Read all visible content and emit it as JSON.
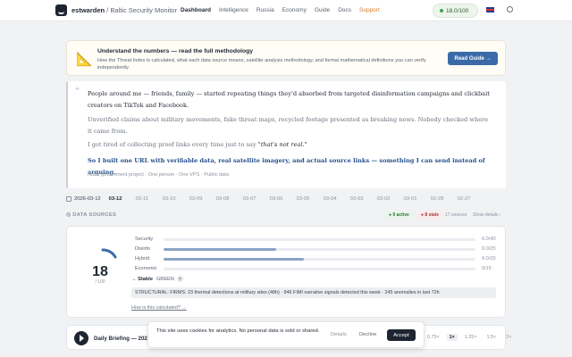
{
  "nav": {
    "brand": "estwarden",
    "subtitle": " / Baltic Security Monitor",
    "links": [
      "Dashboard",
      "Intelligence",
      "Russia",
      "Economy",
      "Guide",
      "Docs",
      "Support"
    ],
    "score": "18.0/100",
    "language_icon": "uk-flag-icon",
    "theme_icon": "moon-icon"
  },
  "banner": {
    "title": "Understand the numbers — read the full methodology",
    "description": "How the Threat Index is calculated, what each data source means, satellite analysis methodology, and formal mathematical definitions you can verify independently.",
    "button": "Read Guide →"
  },
  "quote": {
    "p1": "People around me — friends, family — started repeating things they'd absorbed from targeted disinformation campaigns and clickbait creators on TikTok and Facebook.",
    "p2": "Unverified claims about military movements, fake threat maps, recycled footage presented as breaking news. Nobody checked where it came from.",
    "p3_lead": "I got tired of collecting proof links every time just to say ",
    "p3_emph": "\"that's not real.\"",
    "p4": "So I built one URL with verifiable data, real satellite imagery, and actual source links — something I can send instead of arguing.",
    "footer": "Not a government project · One person · One VPS · Public data"
  },
  "dates": {
    "first": "2026-03-12",
    "items": [
      "03-12",
      "03-11",
      "03-10",
      "03-09",
      "03-08",
      "03-07",
      "03-06",
      "03-05",
      "03-04",
      "03-03",
      "03-02",
      "03-01",
      "02-28",
      "02-27"
    ]
  },
  "sources": {
    "label": "DATA SOURCES",
    "active": "● 9 active",
    "stale": "● 8 stale",
    "count": "17 sources",
    "toggle": "Show details ›"
  },
  "index": {
    "value": "18",
    "out_of": "/ 100",
    "trend": "→ Stable",
    "level": "GREEN",
    "help": "?",
    "components": [
      {
        "name": "Security",
        "value": "0.0/40",
        "fraction": 0.0
      },
      {
        "name": "Disinfo",
        "value": "9.0/25",
        "fraction": 0.36
      },
      {
        "name": "Hybrid",
        "value": "9.0/20",
        "fraction": 0.45
      },
      {
        "name": "Economic",
        "value": "0/15",
        "fraction": 0.0
      }
    ],
    "structural": "STRUCTURAL: FIRMS: 23 thermal detections at military sites (48h) · 946 FIMI narrative signals detected this week · 245 anomalies in last 72h",
    "calc_link": "How is this calculated? →"
  },
  "player": {
    "title": "Daily Briefing — 2026",
    "speeds": [
      "0.75×",
      "1×",
      "1.25×",
      "1.5×",
      "2×"
    ],
    "selected_speed": "1×"
  },
  "cookie": {
    "text": "This site uses cookies for analytics. No personal data is sold or shared.",
    "details": "Details",
    "decline": "Decline",
    "accept": "Accept"
  },
  "colors": {
    "accent": "#3b6aa8",
    "ok": "#3fa34d",
    "stale": "#a33c3c"
  }
}
